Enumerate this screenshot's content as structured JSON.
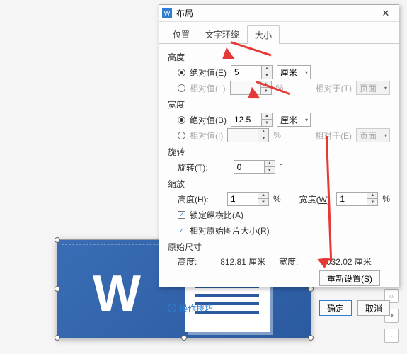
{
  "dialog": {
    "title": "布局",
    "tabs": {
      "pos": "位置",
      "wrap": "文字环绕",
      "size": "大小"
    }
  },
  "height": {
    "label": "高度",
    "abs_label": "绝对值(E)",
    "abs_value": "5",
    "abs_unit": "厘米",
    "rel_label": "相对值(L)",
    "rel_value": "",
    "rel_unit": "%",
    "relative_to_label": "相对于(T)",
    "relative_to_value": "页面"
  },
  "width": {
    "label": "宽度",
    "abs_label": "绝对值(B)",
    "abs_value": "12.5",
    "abs_unit": "厘米",
    "rel_label": "相对值(I)",
    "rel_value": "",
    "rel_unit": "%",
    "relative_to_label": "相对于(E)",
    "relative_to_value": "页面"
  },
  "rotation": {
    "label": "旋转",
    "angle_label": "旋转(T):",
    "value": "0",
    "unit": "°"
  },
  "scale": {
    "label": "缩放",
    "h_label": "高度(H):",
    "h_value": "1",
    "h_unit": "%",
    "w_label": "宽度(W):",
    "w_value": "1",
    "w_unit": "%",
    "lock_label": "锁定纵横比(A)",
    "orig_label": "相对原始图片大小(R)"
  },
  "orig": {
    "label": "原始尺寸",
    "h_label": "高度:",
    "h_value": "812.81 厘米",
    "w_label": "宽度:",
    "w_value": "2032.02 厘米"
  },
  "buttons": {
    "reset": "重新设置(S)",
    "tip": "操作技巧",
    "ok": "确定",
    "cancel": "取消"
  }
}
